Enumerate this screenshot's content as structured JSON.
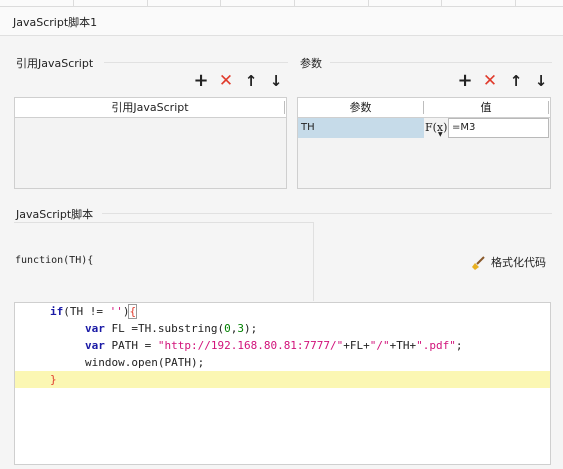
{
  "title": "JavaScript脚本1",
  "referenced_js": {
    "label": "引用JavaScript",
    "column_header": "引用JavaScript",
    "rows": []
  },
  "params": {
    "label": "参数",
    "columns": [
      "参数",
      "值"
    ],
    "rows": [
      {
        "name": "TH",
        "formula_icon": "F(x)",
        "value": "=M3"
      }
    ]
  },
  "toolbar": {
    "add_icon": "plus-icon",
    "delete_icon": "delete-x-icon",
    "up_icon": "arrow-up-icon",
    "down_icon": "arrow-down-icon",
    "delete_color": "#e03b2c"
  },
  "script": {
    "label": "JavaScript脚本",
    "signature": "function(TH){",
    "format_button": "格式化代码",
    "code": {
      "l1": {
        "kw": "if",
        "a": "(TH != ",
        "s": "''",
        "b": ")",
        "brace": "{"
      },
      "l2": {
        "kw": "var",
        "a": " FL =TH.substring(",
        "n1": "0",
        "c": ",",
        "n2": "3",
        "d": ");"
      },
      "l3": {
        "kw": "var",
        "a": " PATH = ",
        "s1": "\"http://192.168.80.81:7777/\"",
        "b": "+FL+",
        "s2": "\"/\"",
        "c": "+TH+",
        "s3": "\".pdf\"",
        "d": ";"
      },
      "l4": {
        "text": "window.open(PATH);"
      },
      "l5": {
        "brace": "}"
      }
    },
    "highlight_color": "#fbf7b3"
  }
}
